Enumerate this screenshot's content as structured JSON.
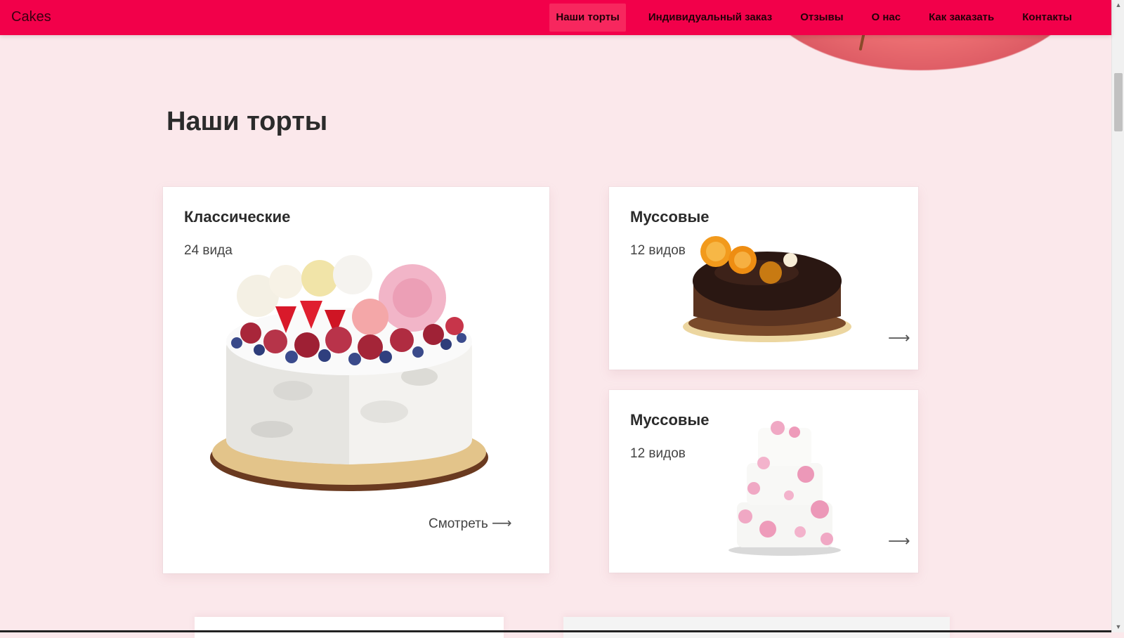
{
  "header": {
    "brand": "Cakes",
    "nav": [
      {
        "label": "Наши торты",
        "active": true
      },
      {
        "label": "Индивидуальный заказ"
      },
      {
        "label": "Отзывы"
      },
      {
        "label": "О нас"
      },
      {
        "label": "Как заказать"
      },
      {
        "label": "Контакты"
      }
    ],
    "accent": "#f2004a"
  },
  "section": {
    "title": "Наши торты"
  },
  "cards": [
    {
      "title": "Классические",
      "count": "24 вида",
      "link": "Смотреть",
      "arrow": "⟶",
      "image": "berry-cake-illustration"
    },
    {
      "title": "Муссовые",
      "count": "12 видов",
      "arrow": "⟶",
      "image": "chocolate-mousse-cake-illustration"
    },
    {
      "title": "Муссовые",
      "count": "12 видов",
      "arrow": "⟶",
      "image": "tiered-wedding-cake-illustration"
    }
  ],
  "colors": {
    "background": "#fbe8eb",
    "card": "#ffffff",
    "text": "#2b2b2b"
  }
}
